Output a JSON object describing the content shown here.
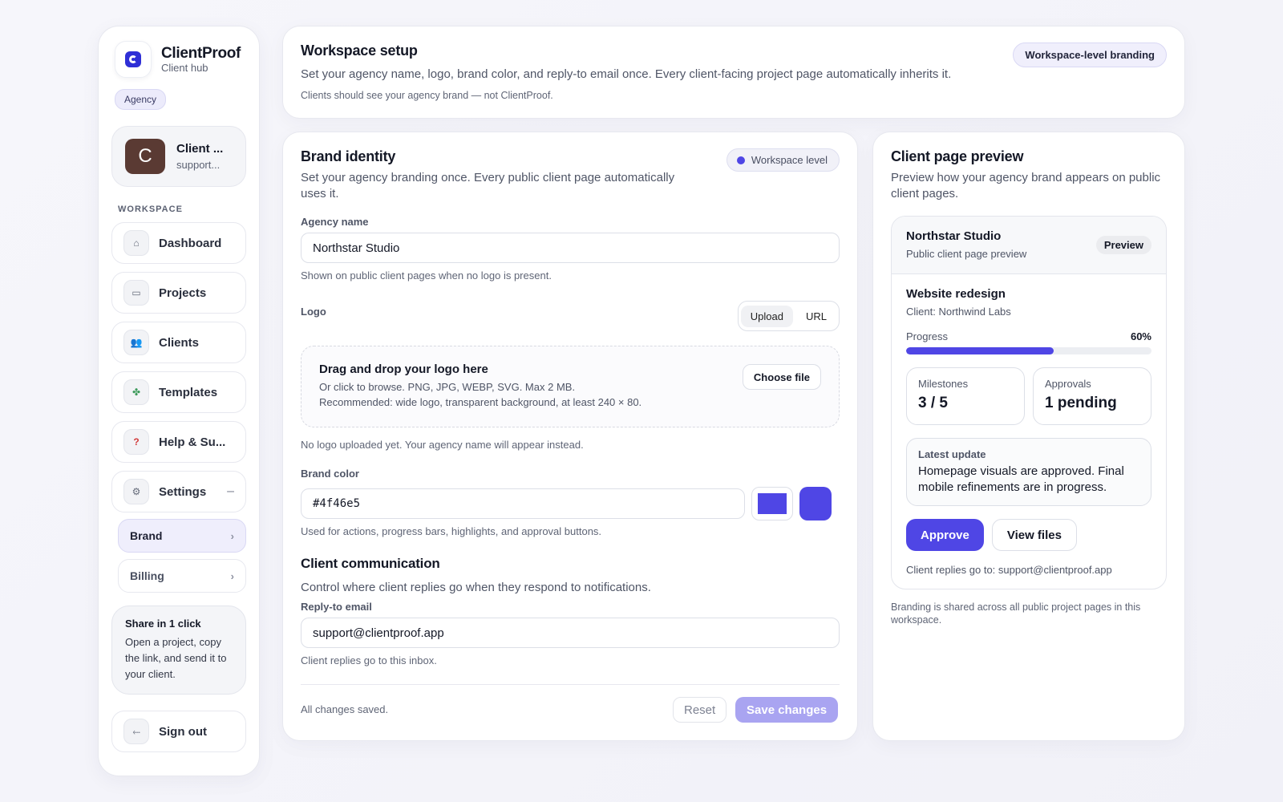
{
  "sidebar": {
    "app_name": "ClientProof",
    "app_sub": "Client hub",
    "role_badge": "Agency",
    "user": {
      "initial": "C",
      "name": "Client ...",
      "email": "support..."
    },
    "section_label": "WORKSPACE",
    "nav": [
      {
        "label": "Dashboard",
        "icon": "home-icon",
        "glyph": "⌂"
      },
      {
        "label": "Projects",
        "icon": "folder-icon",
        "glyph": "▭"
      },
      {
        "label": "Clients",
        "icon": "users-icon",
        "glyph": "👥"
      },
      {
        "label": "Templates",
        "icon": "puzzle-icon",
        "glyph": "✤"
      },
      {
        "label": "Help & Su...",
        "icon": "question-icon",
        "glyph": "?"
      },
      {
        "label": "Settings",
        "icon": "gear-icon",
        "glyph": "⚙"
      }
    ],
    "settings_collapse": "–",
    "sub_nav": [
      {
        "label": "Brand",
        "active": true
      },
      {
        "label": "Billing",
        "active": false
      }
    ],
    "share": {
      "title": "Share in 1 click",
      "text": "Open a project, copy the link, and send it to your client."
    },
    "signout": {
      "label": "Sign out",
      "icon": "logout-icon",
      "glyph": "⬸"
    }
  },
  "header": {
    "title": "Workspace setup",
    "description": "Set your agency name, logo, brand color, and reply-to email once. Every client-facing project page automatically inherits it.",
    "note": "Clients should see your agency brand — not ClientProof.",
    "badge": "Workspace-level branding"
  },
  "brand": {
    "title": "Brand identity",
    "description": "Set your agency branding once. Every public client page automatically uses it.",
    "badge": "Workspace level",
    "agency_name": {
      "label": "Agency name",
      "value": "Northstar Studio",
      "help": "Shown on public client pages when no logo is present."
    },
    "logo": {
      "label": "Logo",
      "tabs": [
        "Upload",
        "URL"
      ],
      "dropzone_title": "Drag and drop your logo here",
      "dropzone_line1": "Or click to browse. PNG, JPG, WEBP, SVG. Max 2 MB.",
      "dropzone_line2": "Recommended: wide logo, transparent background, at least 240 × 80.",
      "choose_label": "Choose file",
      "status": "No logo uploaded yet. Your agency name will appear instead."
    },
    "color": {
      "label": "Brand color",
      "value": "#4f46e5",
      "help": "Used for actions, progress bars, highlights, and approval buttons."
    },
    "communication": {
      "title": "Client communication",
      "description": "Control where client replies go when they respond to notifications.",
      "reply_label": "Reply-to email",
      "reply_value": "support@clientproof.app",
      "reply_help": "Client replies go to this inbox."
    },
    "footer": {
      "status": "All changes saved.",
      "reset": "Reset",
      "save": "Save changes"
    }
  },
  "preview": {
    "title": "Client page preview",
    "description": "Preview how your agency brand appears on public client pages.",
    "card": {
      "agency": "Northstar Studio",
      "subtitle": "Public client page preview",
      "badge": "Preview",
      "project": "Website redesign",
      "client": "Client: Northwind Labs",
      "progress_label": "Progress",
      "progress_value": "60%",
      "progress_fraction": 0.6,
      "milestones_label": "Milestones",
      "milestones_value": "3 / 5",
      "approvals_label": "Approvals",
      "approvals_value": "1 pending",
      "update_label": "Latest update",
      "update_text": "Homepage visuals are approved. Final mobile refinements are in progress.",
      "approve": "Approve",
      "view_files": "View files",
      "reply_note": "Client replies go to: support@clientproof.app"
    },
    "footnote": "Branding is shared across all public project pages in this workspace."
  },
  "colors": {
    "brand": "#4f46e5",
    "save_disabled": "#a9a4f1",
    "avatar": "#5a3a33"
  }
}
